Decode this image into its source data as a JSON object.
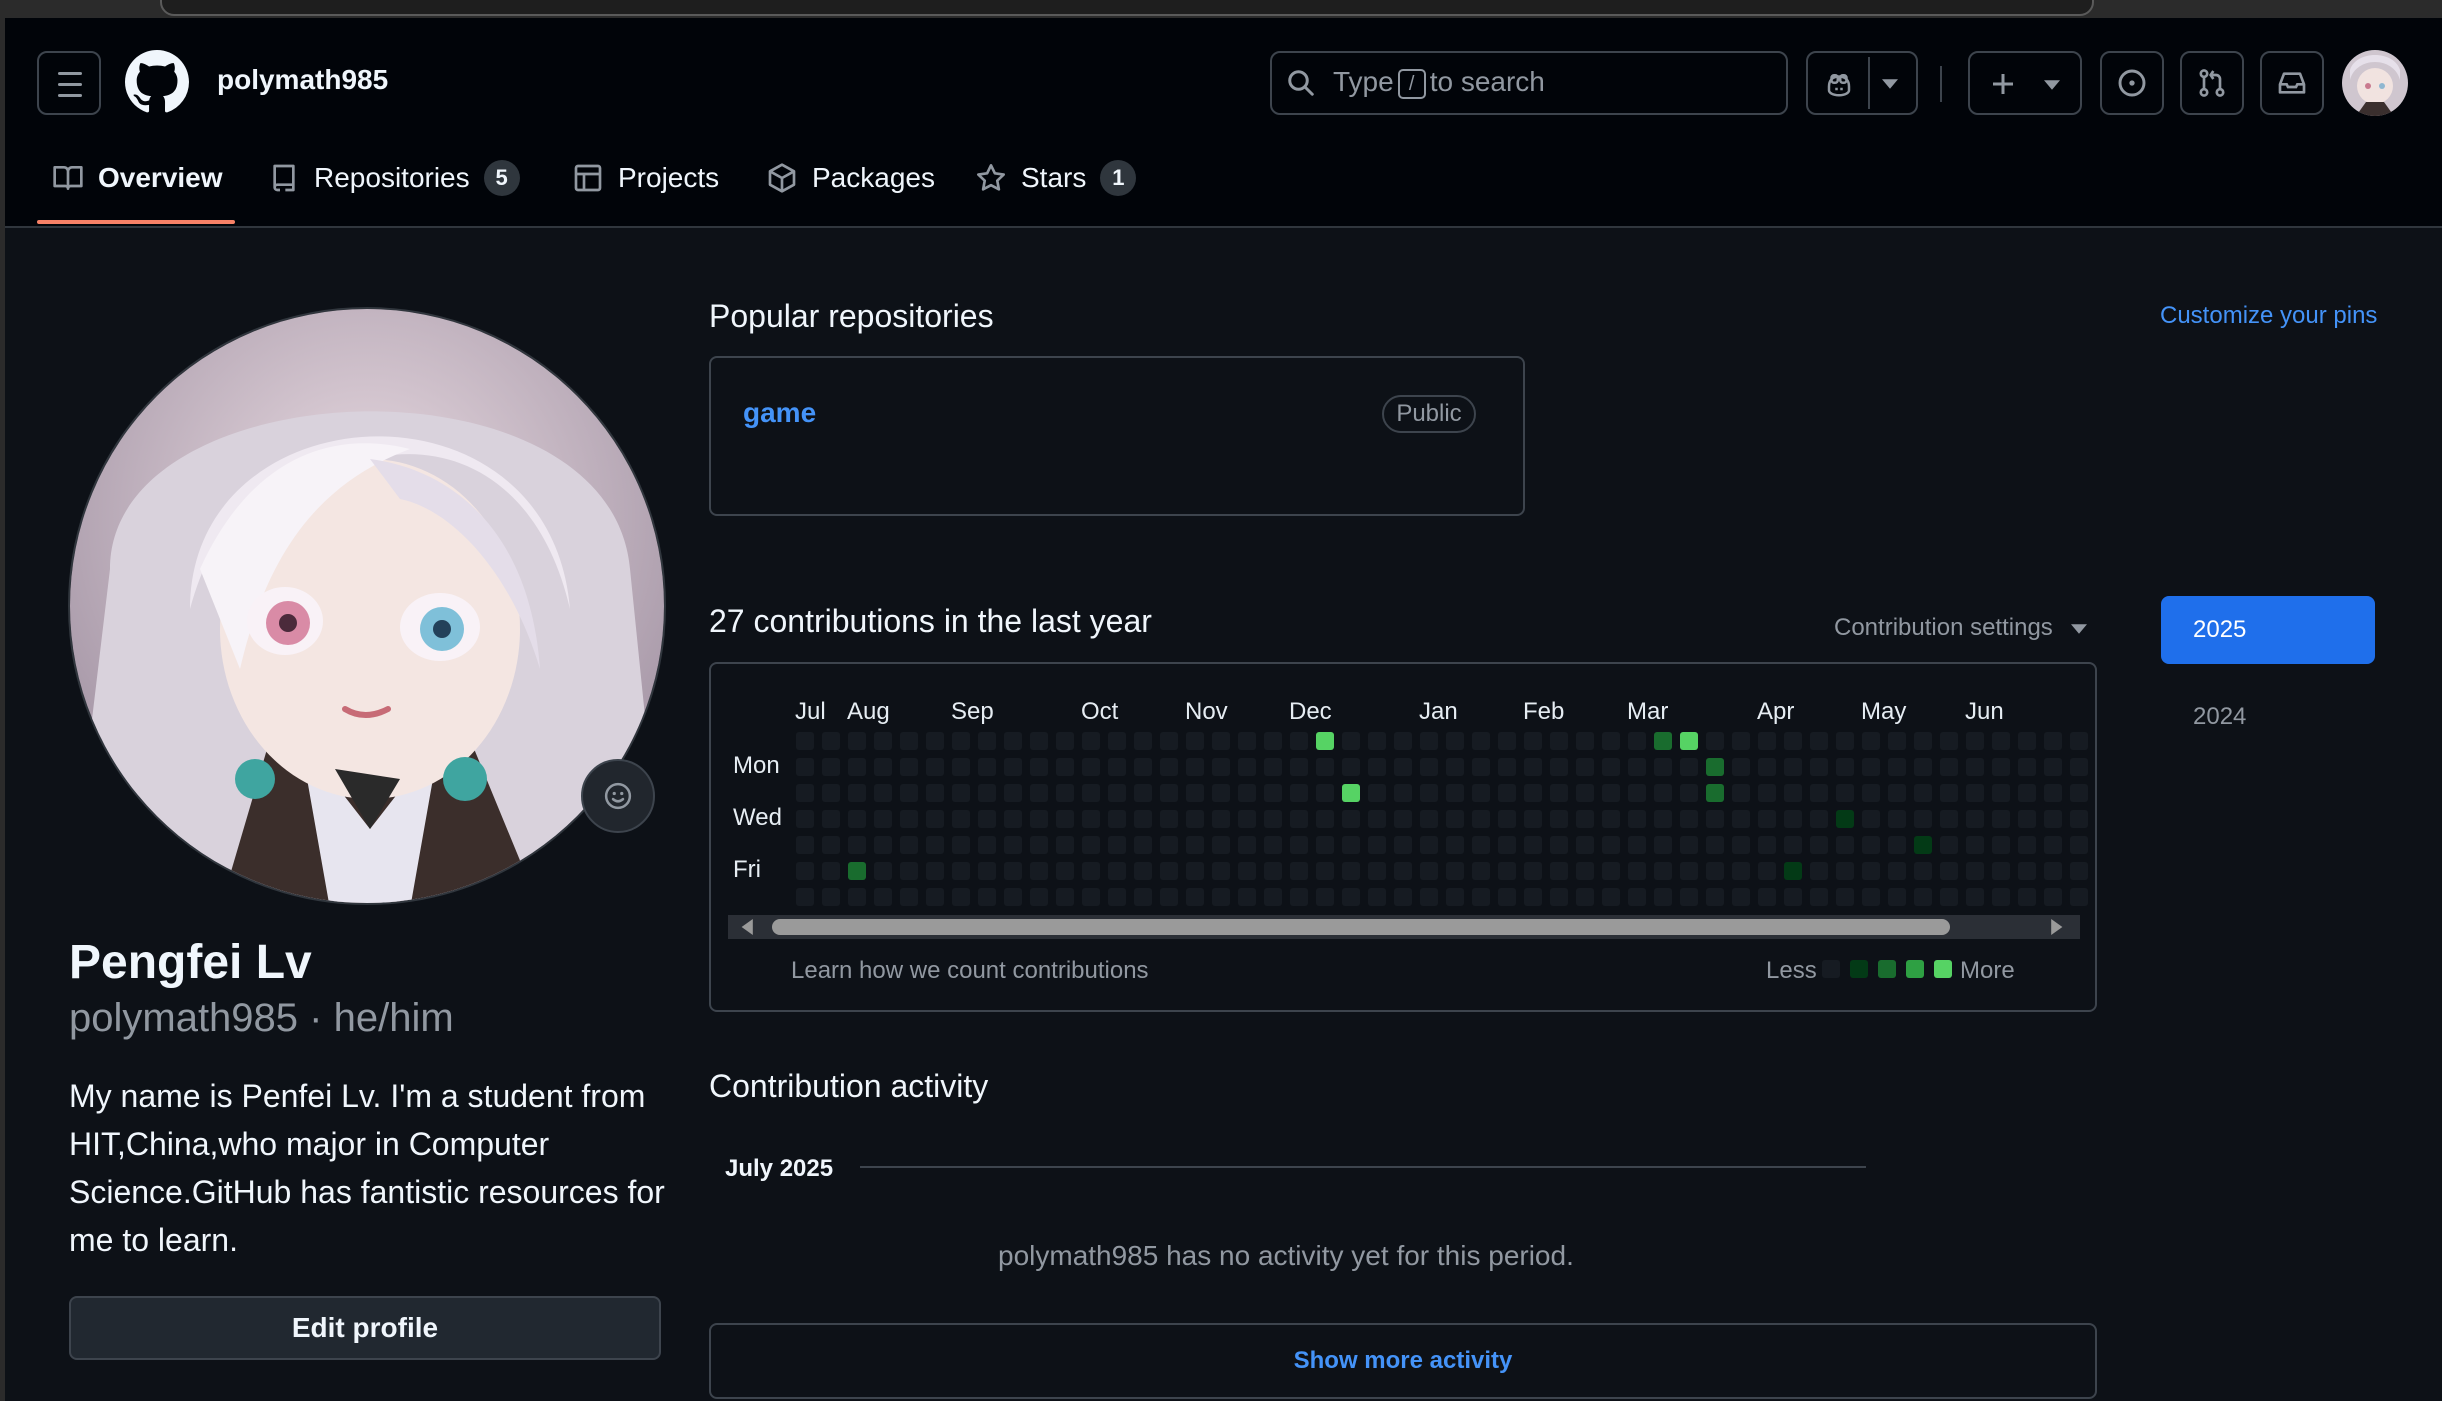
{
  "header": {
    "username": "polymath985",
    "search": {
      "prefix": "Type",
      "key": "/",
      "suffix": "to search"
    }
  },
  "tabs": [
    {
      "label": "Overview",
      "count": null
    },
    {
      "label": "Repositories",
      "count": "5"
    },
    {
      "label": "Projects",
      "count": null
    },
    {
      "label": "Packages",
      "count": null
    },
    {
      "label": "Stars",
      "count": "1"
    }
  ],
  "profile": {
    "full_name": "Pengfei Lv",
    "login_line": "polymath985 · he/him",
    "bio": "My name is Penfei Lv. I'm a student from HIT,China,who major in Computer Science.GitHub has fantistic resources for me to learn.",
    "edit_label": "Edit profile"
  },
  "pinned": {
    "title": "Popular repositories",
    "customize_label": "Customize your pins",
    "repos": [
      {
        "name": "game",
        "visibility": "Public"
      }
    ]
  },
  "contributions": {
    "title": "27 contributions in the last year",
    "settings_label": "Contribution settings",
    "months": [
      "Jul",
      "Aug",
      "Sep",
      "Oct",
      "Nov",
      "Dec",
      "Jan",
      "Feb",
      "Mar",
      "Apr",
      "May",
      "Jun"
    ],
    "days": [
      "Mon",
      "Wed",
      "Fri"
    ],
    "learn_label": "Learn how we count contributions",
    "less_label": "Less",
    "more_label": "More",
    "levels_colors": [
      "#161b22",
      "#033a16",
      "#196c2e",
      "#2ea043",
      "#56d364"
    ],
    "active_cells": [
      {
        "week": 2,
        "day": 5,
        "level": 2
      },
      {
        "week": 20,
        "day": 0,
        "level": 4
      },
      {
        "week": 21,
        "day": 2,
        "level": 4
      },
      {
        "week": 33,
        "day": 0,
        "level": 2
      },
      {
        "week": 34,
        "day": 0,
        "level": 4
      },
      {
        "week": 35,
        "day": 1,
        "level": 2
      },
      {
        "week": 35,
        "day": 2,
        "level": 2
      },
      {
        "week": 38,
        "day": 5,
        "level": 1
      },
      {
        "week": 40,
        "day": 3,
        "level": 1
      },
      {
        "week": 43,
        "day": 4,
        "level": 1
      }
    ]
  },
  "years": {
    "selected": "2025",
    "other": "2024"
  },
  "activity": {
    "title": "Contribution activity",
    "month": "July 2025",
    "empty_message": "polymath985 has no activity yet for this period.",
    "show_more_label": "Show more activity"
  }
}
